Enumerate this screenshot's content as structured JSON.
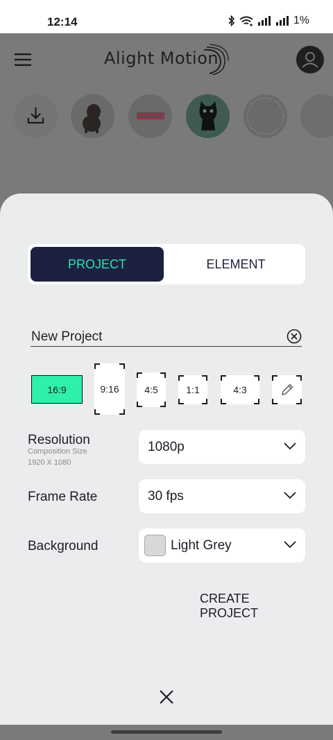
{
  "status_bar": {
    "time": "12:14",
    "battery": "1%",
    "icons": [
      "bluetooth-icon",
      "wifi-icon",
      "signal-icon",
      "signal-icon",
      "battery-icon"
    ]
  },
  "app": {
    "logo_text": "Alight Motion",
    "menu_icon": "hamburger-menu-icon",
    "profile_icon": "profile-icon"
  },
  "recent_projects": {
    "import_icon": "download-icon",
    "items": [
      "dog-thumbnail",
      "title-text-thumbnail",
      "black-cat-thumbnail",
      "dotted-circle-thumbnail",
      "pattern-thumbnail"
    ]
  },
  "sheet": {
    "tabs": [
      {
        "label": "PROJECT",
        "selected": true
      },
      {
        "label": "ELEMENT",
        "selected": false
      }
    ],
    "project_name": {
      "value": "New Project",
      "clear_icon": "clear-circle-icon"
    },
    "aspect_ratios": [
      {
        "label": "16:9",
        "selected": true
      },
      {
        "label": "9:16",
        "selected": false
      },
      {
        "label": "4:5",
        "selected": false
      },
      {
        "label": "1:1",
        "selected": false
      },
      {
        "label": "4:3",
        "selected": false
      },
      {
        "label": "",
        "icon": "pencil-icon",
        "selected": false
      }
    ],
    "resolution": {
      "label": "Resolution",
      "sub_label": "Composition Size",
      "size": "1920 X 1080",
      "value": "1080p"
    },
    "frame_rate": {
      "label": "Frame Rate",
      "value": "30 fps"
    },
    "background": {
      "label": "Background",
      "value": "Light Grey",
      "swatch_color": "#d8d8d8"
    },
    "create_button": "CREATE PROJECT",
    "close_icon": "close-icon"
  },
  "colors": {
    "accent": "#2ef0a8",
    "navy": "#1c2140",
    "sheet_bg": "#ebecee"
  }
}
